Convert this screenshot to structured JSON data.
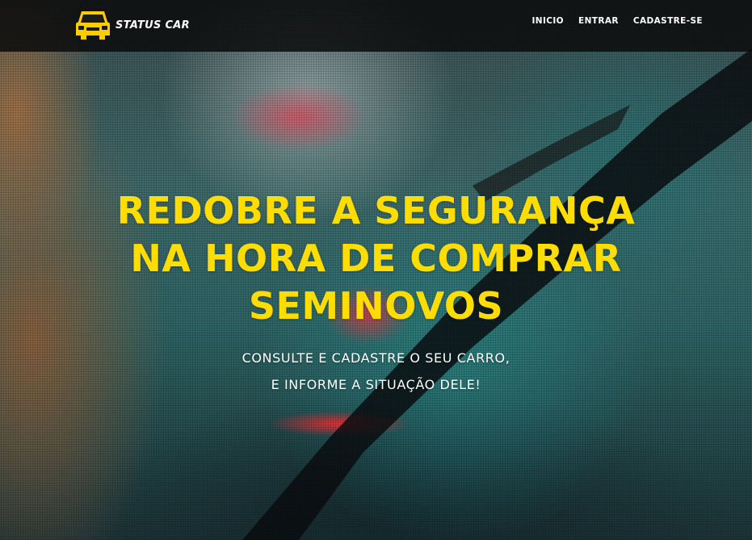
{
  "brand": {
    "name": "STATUS CAR",
    "logo_icon": "car-icon",
    "logo_color": "#ffcc00"
  },
  "nav": {
    "items": [
      {
        "label": "INICIO"
      },
      {
        "label": "ENTRAR"
      },
      {
        "label": "CADASTRE-SE"
      }
    ]
  },
  "hero": {
    "title_lines": [
      "REDOBRE A SEGURANÇA",
      "NA HORA DE COMPRAR",
      "SEMINOVOS"
    ],
    "subtitle_lines": [
      "CONSULTE E CADASTRE O SEU CARRO,",
      "E INFORME A SITUAÇÃO DELE!"
    ],
    "title_color": "#ffdd00"
  }
}
